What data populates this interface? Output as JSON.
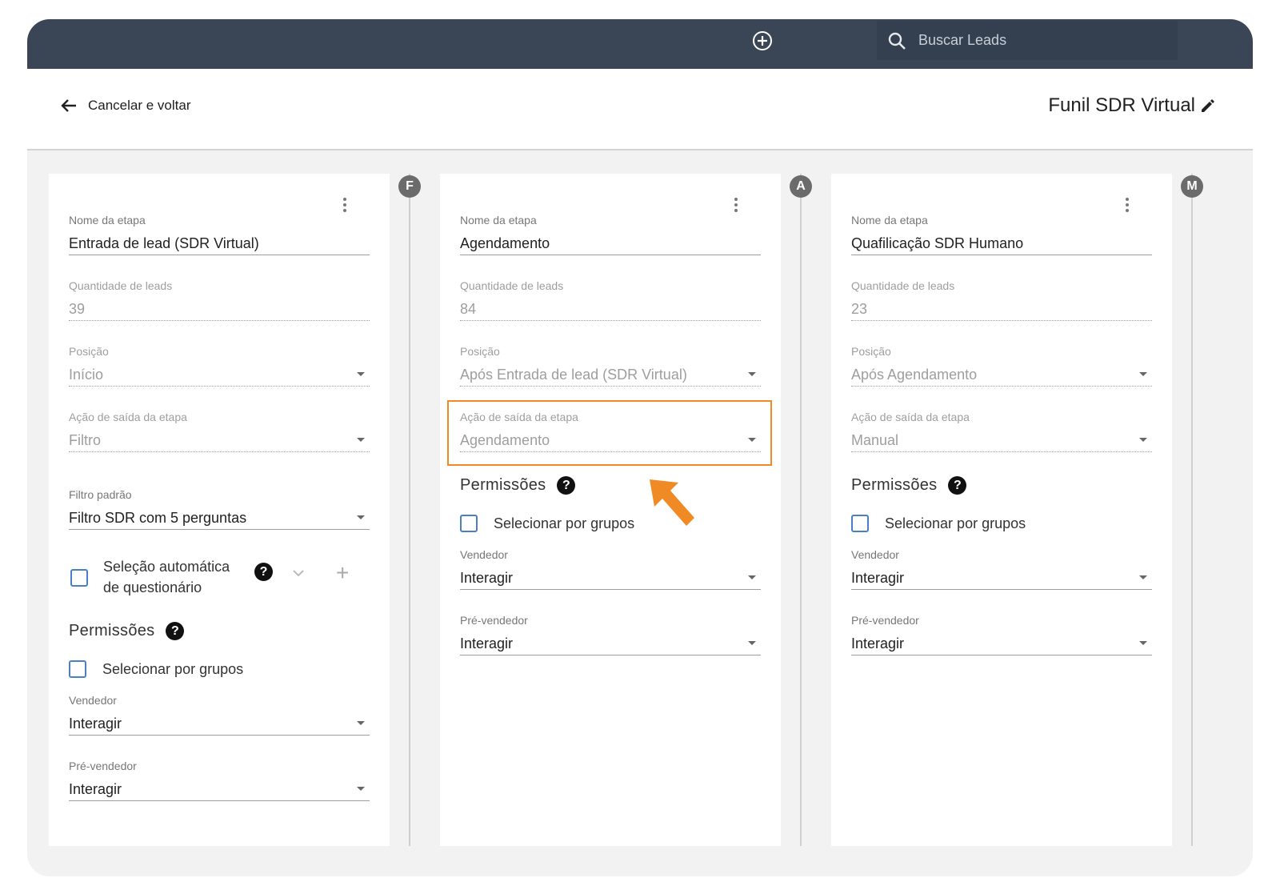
{
  "topbar": {
    "add_icon": "plus-circle-icon",
    "search_placeholder": "Buscar Leads",
    "search_icon": "search-icon"
  },
  "header": {
    "back_label": "Cancelar e voltar",
    "funnel_title": "Funil SDR Virtual"
  },
  "stages": [
    {
      "name_label": "Nome da etapa",
      "name_value": "Entrada de lead (SDR Virtual)",
      "qty_label": "Quantidade de leads",
      "qty_value": "39",
      "pos_label": "Posição",
      "pos_value": "Início",
      "exit_label": "Ação de saída da etapa",
      "exit_value": "Filtro",
      "filter_label": "Filtro padrão",
      "filter_value": "Filtro SDR com 5 perguntas",
      "auto_label": "Seleção automática de questionário",
      "perm_title": "Permissões",
      "groups_label": "Selecionar por grupos",
      "seller_label": "Vendedor",
      "seller_value": "Interagir",
      "presales_label": "Pré-vendedor",
      "presales_value": "Interagir",
      "badge": "F"
    },
    {
      "name_label": "Nome da etapa",
      "name_value": "Agendamento",
      "qty_label": "Quantidade de leads",
      "qty_value": "84",
      "pos_label": "Posição",
      "pos_value": "Após Entrada de lead (SDR Virtual)",
      "exit_label": "Ação de saída da etapa",
      "exit_value": "Agendamento",
      "perm_title": "Permissões",
      "groups_label": "Selecionar por grupos",
      "seller_label": "Vendedor",
      "seller_value": "Interagir",
      "presales_label": "Pré-vendedor",
      "presales_value": "Interagir",
      "badge": "A"
    },
    {
      "name_label": "Nome da etapa",
      "name_value": "Quafilicação SDR Humano",
      "qty_label": "Quantidade de leads",
      "qty_value": "23",
      "pos_label": "Posição",
      "pos_value": "Após Agendamento",
      "exit_label": "Ação de saída da etapa",
      "exit_value": "Manual",
      "perm_title": "Permissões",
      "groups_label": "Selecionar por grupos",
      "seller_label": "Vendedor",
      "seller_value": "Interagir",
      "presales_label": "Pré-vendedor",
      "presales_value": "Interagir",
      "badge": "M"
    }
  ],
  "colors": {
    "topbar": "#3a4556",
    "highlight": "#f08a24",
    "checkbox": "#4a7fc1"
  }
}
